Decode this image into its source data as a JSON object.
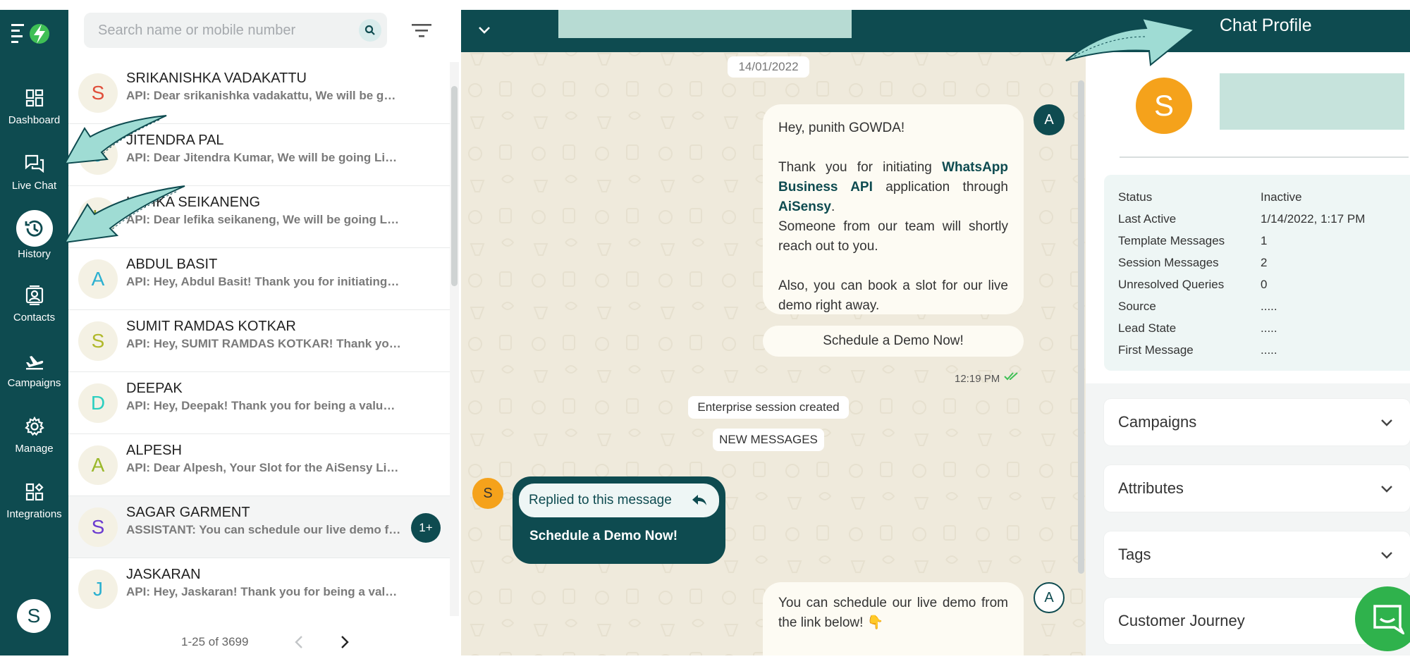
{
  "nav": {
    "items": [
      {
        "label": "Dashboard",
        "icon": "dashboard-icon"
      },
      {
        "label": "Live Chat",
        "icon": "chat-icon"
      },
      {
        "label": "History",
        "icon": "history-icon",
        "active": true
      },
      {
        "label": "Contacts",
        "icon": "contacts-icon"
      },
      {
        "label": "Campaigns",
        "icon": "plane-icon"
      },
      {
        "label": "Manage",
        "icon": "gear-icon"
      },
      {
        "label": "Integrations",
        "icon": "integrations-icon"
      }
    ],
    "user_initial": "S"
  },
  "list": {
    "search_placeholder": "Search name or mobile number",
    "chats": [
      {
        "initial": "S",
        "name": "SRIKANISHKA VADAKATTU",
        "preview": "API: Dear srikanishka vadakattu, We will be goi...",
        "color": "#e04e3a"
      },
      {
        "initial": "J",
        "name": "JITENDRA PAL",
        "preview": "API: Dear Jitendra Kumar, We will be going Live ...",
        "color": "#2bb0d0"
      },
      {
        "initial": "L",
        "name": "LEFIKA SEIKANENG",
        "preview": "API: Dear lefika seikaneng, We will be going Liv...",
        "color": "#8a9a2a"
      },
      {
        "initial": "A",
        "name": "ABDUL BASIT",
        "preview": "API: Hey, Abdul Basit! Thank you for initiating *...",
        "color": "#2bb0d0"
      },
      {
        "initial": "S",
        "name": "SUMIT RAMDAS KOTKAR",
        "preview": "API: Hey, SUMIT RAMDAS KOTKAR! Thank you f...",
        "color": "#b0b82a"
      },
      {
        "initial": "D",
        "name": "DEEPAK",
        "preview": "API: Hey, Deepak! Thank you for being a valuabl...",
        "color": "#2bcfc0"
      },
      {
        "initial": "A",
        "name": "ALPESH",
        "preview": "API: Dear Alpesh, Your Slot for the AiSensy Live...",
        "color": "#9ab82a"
      },
      {
        "initial": "S",
        "name": "SAGAR GARMENT",
        "preview": "ASSISTANT: You can schedule our live demo fr...",
        "color": "#6a3ad0",
        "badge": "1+",
        "selected": true
      },
      {
        "initial": "J",
        "name": "JASKARAN",
        "preview": "API: Hey, Jaskaran! Thank you for being a valua...",
        "color": "#2bb0d0"
      }
    ],
    "pagination": "1-25 of 3699"
  },
  "conversation": {
    "date": "14/01/2022",
    "agent_initial": "A",
    "bot_message": {
      "greeting": "Hey, punith GOWDA!",
      "l1_a": "Thank you for initiating ",
      "l1_b": "WhatsApp Business API",
      "l1_c": " application through ",
      "l1_d": "AiSensy",
      "l1_e": ".",
      "l2": "Someone from our team will shortly reach out to you.",
      "l3": "Also, you can book a slot for our live demo right away."
    },
    "button_label": "Schedule a Demo Now!",
    "time": "12:19 PM",
    "system_1": "Enterprise session created",
    "system_2": "NEW MESSAGES",
    "user_initial": "S",
    "reply_quote": "Replied to this message",
    "reply_text": "Schedule a Demo Now!",
    "last_message": "You can schedule our live demo from the link below! 👇"
  },
  "profile": {
    "title": "Chat Profile",
    "initial": "S",
    "details": [
      {
        "key": "Status",
        "value": "Inactive"
      },
      {
        "key": "Last Active",
        "value": "1/14/2022, 1:17 PM"
      },
      {
        "key": "Template Messages",
        "value": "1"
      },
      {
        "key": "Session Messages",
        "value": "2"
      },
      {
        "key": "Unresolved Queries",
        "value": "0"
      },
      {
        "key": "Source",
        "value": "....."
      },
      {
        "key": "Lead State",
        "value": "....."
      },
      {
        "key": "First Message",
        "value": "....."
      }
    ],
    "sections": [
      "Campaigns",
      "Attributes",
      "Tags",
      "Customer Journey"
    ]
  },
  "colors": {
    "brand": "#0e4b50",
    "accent": "#2fb24c",
    "avatar": "#f5a21b",
    "arrow": "#9fdcd4"
  }
}
